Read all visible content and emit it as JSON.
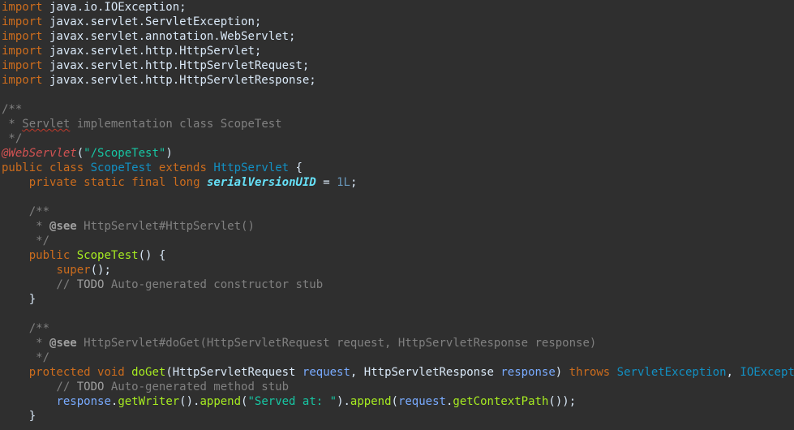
{
  "code_lines": [
    [
      {
        "t": "import",
        "c": "kw"
      },
      {
        "t": " java.io.IOException;",
        "c": "plain"
      }
    ],
    [
      {
        "t": "import",
        "c": "kw"
      },
      {
        "t": " javax.servlet.ServletException;",
        "c": "plain"
      }
    ],
    [
      {
        "t": "import",
        "c": "kw"
      },
      {
        "t": " javax.servlet.annotation.WebServlet;",
        "c": "plain"
      }
    ],
    [
      {
        "t": "import",
        "c": "kw"
      },
      {
        "t": " javax.servlet.http.HttpServlet;",
        "c": "plain"
      }
    ],
    [
      {
        "t": "import",
        "c": "kw"
      },
      {
        "t": " javax.servlet.http.HttpServletRequest;",
        "c": "plain"
      }
    ],
    [
      {
        "t": "import",
        "c": "kw"
      },
      {
        "t": " javax.servlet.http.HttpServletResponse;",
        "c": "plain"
      }
    ],
    [],
    [
      {
        "t": "/**",
        "c": "javadoc"
      }
    ],
    [
      {
        "t": " * ",
        "c": "javadoc"
      },
      {
        "t": "Servlet",
        "c": "misspelled"
      },
      {
        "t": " implementation class ScopeTest",
        "c": "javadoc"
      }
    ],
    [
      {
        "t": " */",
        "c": "javadoc"
      }
    ],
    [
      {
        "t": "@WebServlet",
        "c": "anno"
      },
      {
        "t": "(",
        "c": "plain"
      },
      {
        "t": "\"/ScopeTest\"",
        "c": "string"
      },
      {
        "t": ")",
        "c": "plain"
      }
    ],
    [
      {
        "t": "public",
        "c": "kw"
      },
      {
        "t": " ",
        "c": "plain"
      },
      {
        "t": "class",
        "c": "kw"
      },
      {
        "t": " ",
        "c": "plain"
      },
      {
        "t": "ScopeTest",
        "c": "classname"
      },
      {
        "t": " ",
        "c": "plain"
      },
      {
        "t": "extends",
        "c": "kw"
      },
      {
        "t": " ",
        "c": "plain"
      },
      {
        "t": "HttpServlet",
        "c": "type"
      },
      {
        "t": " {",
        "c": "plain"
      }
    ],
    [
      {
        "t": "    ",
        "c": "plain"
      },
      {
        "t": "private",
        "c": "kw"
      },
      {
        "t": " ",
        "c": "plain"
      },
      {
        "t": "static",
        "c": "kw"
      },
      {
        "t": " ",
        "c": "plain"
      },
      {
        "t": "final",
        "c": "kw"
      },
      {
        "t": " ",
        "c": "plain"
      },
      {
        "t": "long",
        "c": "kw"
      },
      {
        "t": " ",
        "c": "plain"
      },
      {
        "t": "serialVersionUID",
        "c": "field"
      },
      {
        "t": " = ",
        "c": "plain"
      },
      {
        "t": "1L",
        "c": "number"
      },
      {
        "t": ";",
        "c": "plain"
      }
    ],
    [],
    [
      {
        "t": "    /**",
        "c": "javadoc"
      }
    ],
    [
      {
        "t": "     * ",
        "c": "javadoc"
      },
      {
        "t": "@see",
        "c": "doctag"
      },
      {
        "t": " HttpServlet#HttpServlet()",
        "c": "javadoc"
      }
    ],
    [
      {
        "t": "     */",
        "c": "javadoc"
      }
    ],
    [
      {
        "t": "    ",
        "c": "plain"
      },
      {
        "t": "public",
        "c": "kw"
      },
      {
        "t": " ",
        "c": "plain"
      },
      {
        "t": "ScopeTest",
        "c": "method"
      },
      {
        "t": "() {",
        "c": "plain"
      }
    ],
    [
      {
        "t": "        ",
        "c": "plain"
      },
      {
        "t": "super",
        "c": "kw"
      },
      {
        "t": "();",
        "c": "plain"
      }
    ],
    [
      {
        "t": "        // ",
        "c": "comment"
      },
      {
        "t": "TODO",
        "c": "todo"
      },
      {
        "t": " Auto-generated constructor stub",
        "c": "comment"
      }
    ],
    [
      {
        "t": "    }",
        "c": "plain"
      }
    ],
    [],
    [
      {
        "t": "    /**",
        "c": "javadoc"
      }
    ],
    [
      {
        "t": "     * ",
        "c": "javadoc"
      },
      {
        "t": "@see",
        "c": "doctag"
      },
      {
        "t": " HttpServlet#doGet(HttpServletRequest request, HttpServletResponse response)",
        "c": "javadoc"
      }
    ],
    [
      {
        "t": "     */",
        "c": "javadoc"
      }
    ],
    [
      {
        "t": "    ",
        "c": "plain"
      },
      {
        "t": "protected",
        "c": "kw"
      },
      {
        "t": " ",
        "c": "plain"
      },
      {
        "t": "void",
        "c": "kw"
      },
      {
        "t": " ",
        "c": "plain"
      },
      {
        "t": "doGet",
        "c": "method"
      },
      {
        "t": "(HttpServletRequest ",
        "c": "plain"
      },
      {
        "t": "request",
        "c": "var"
      },
      {
        "t": ", HttpServletResponse ",
        "c": "plain"
      },
      {
        "t": "response",
        "c": "var"
      },
      {
        "t": ") ",
        "c": "plain"
      },
      {
        "t": "throws",
        "c": "kw"
      },
      {
        "t": " ",
        "c": "plain"
      },
      {
        "t": "ServletException",
        "c": "type"
      },
      {
        "t": ", ",
        "c": "plain"
      },
      {
        "t": "IOException",
        "c": "type"
      },
      {
        "t": " {",
        "c": "plain"
      }
    ],
    [
      {
        "t": "        // ",
        "c": "comment"
      },
      {
        "t": "TODO",
        "c": "todo"
      },
      {
        "t": " Auto-generated method stub",
        "c": "comment"
      }
    ],
    [
      {
        "t": "        ",
        "c": "plain"
      },
      {
        "t": "response",
        "c": "var"
      },
      {
        "t": ".",
        "c": "plain"
      },
      {
        "t": "getWriter",
        "c": "call"
      },
      {
        "t": "().",
        "c": "plain"
      },
      {
        "t": "append",
        "c": "call"
      },
      {
        "t": "(",
        "c": "plain"
      },
      {
        "t": "\"Served at: \"",
        "c": "string"
      },
      {
        "t": ").",
        "c": "plain"
      },
      {
        "t": "append",
        "c": "call"
      },
      {
        "t": "(",
        "c": "plain"
      },
      {
        "t": "request",
        "c": "var"
      },
      {
        "t": ".",
        "c": "plain"
      },
      {
        "t": "getContextPath",
        "c": "call"
      },
      {
        "t": "());",
        "c": "plain"
      }
    ],
    [
      {
        "t": "    }",
        "c": "plain"
      }
    ]
  ],
  "theme_colors": {
    "background": "#2f2f2f",
    "keyword": "#cc6c1d",
    "comment": "#808080",
    "annotation": "#d25252",
    "string": "#17c6a3",
    "type": "#1290c3",
    "method": "#a7ec21",
    "field": "#66e1f8",
    "variable": "#79abff",
    "plain": "#d9e8f7"
  }
}
